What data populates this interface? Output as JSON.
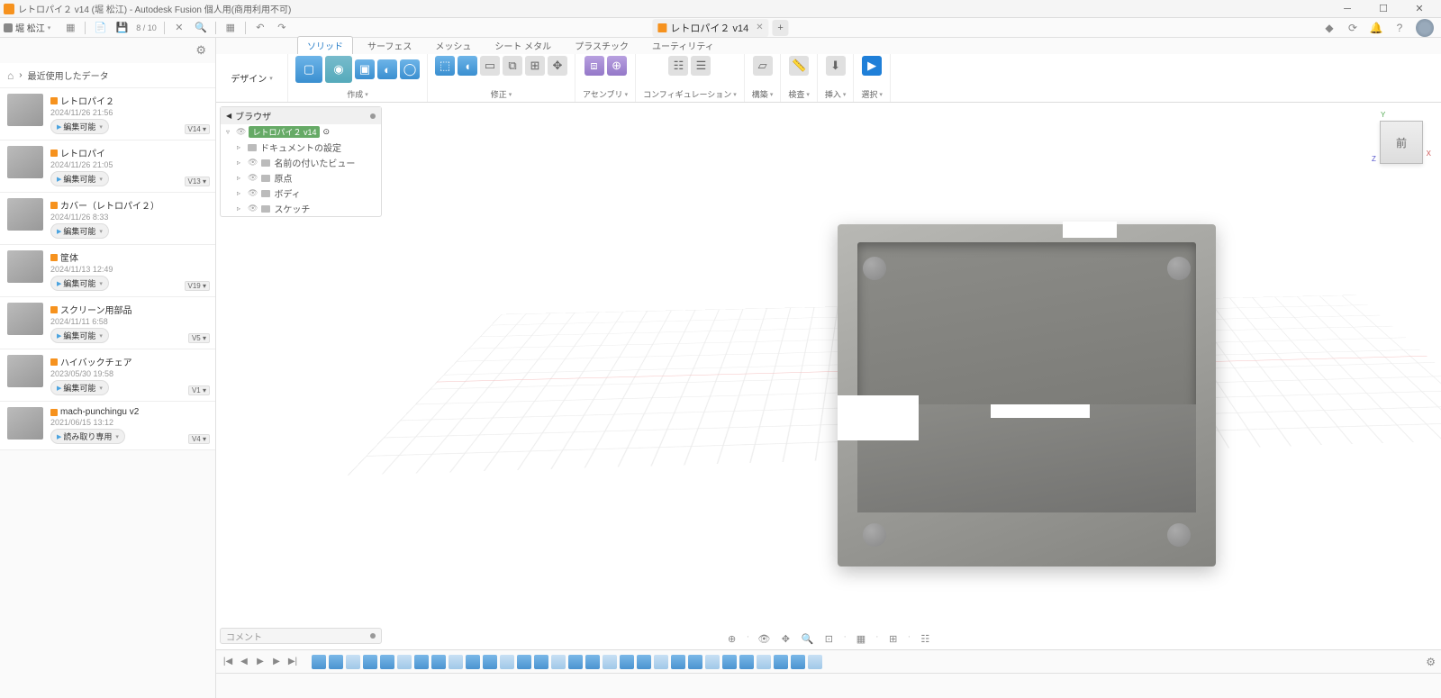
{
  "window": {
    "title": "レトロパイ２ v14 (堀 松江) - Autodesk Fusion 個人用(商用利用不可)"
  },
  "user": {
    "name": "堀 松江"
  },
  "qat": {
    "save_count": "8 / 10"
  },
  "doc_tab": {
    "name": "レトロパイ２ v14"
  },
  "breadcrumb": {
    "label": "最近使用したデータ"
  },
  "design_btn": "デザイン",
  "ribbon_tabs": [
    "ソリッド",
    "サーフェス",
    "メッシュ",
    "シート メタル",
    "プラスチック",
    "ユーティリティ"
  ],
  "ribbon_groups": [
    "作成",
    "修正",
    "アセンブリ",
    "コンフィギュレーション",
    "構築",
    "検査",
    "挿入",
    "選択"
  ],
  "browser": {
    "title": "ブラウザ",
    "root": "レトロパイ２ v14",
    "nodes": [
      "ドキュメントの設定",
      "名前の付いたビュー",
      "原点",
      "ボディ",
      "スケッチ"
    ]
  },
  "viewcube_face": "前",
  "comment_label": "コメント",
  "data_items": [
    {
      "name": "レトロパイ２",
      "date": "2024/11/26 21:56",
      "btn": "編集可能",
      "ver": "V14"
    },
    {
      "name": "レトロパイ",
      "date": "2024/11/26 21:05",
      "btn": "編集可能",
      "ver": "V13"
    },
    {
      "name": "カバー（レトロパイ２）",
      "date": "2024/11/26 8:33",
      "btn": "編集可能",
      "ver": ""
    },
    {
      "name": "筐体",
      "date": "2024/11/13 12:49",
      "btn": "編集可能",
      "ver": "V19"
    },
    {
      "name": "スクリーン用部品",
      "date": "2024/11/11 6:58",
      "btn": "編集可能",
      "ver": "V5"
    },
    {
      "name": "ハイバックチェア",
      "date": "2023/05/30 19:58",
      "btn": "編集可能",
      "ver": "V1"
    },
    {
      "name": "mach-punchingu v2",
      "date": "2021/06/15 13:12",
      "btn": "読み取り専用",
      "ver": "V4"
    }
  ]
}
